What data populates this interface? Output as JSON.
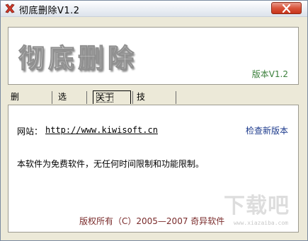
{
  "window": {
    "title": "彻底删除V1.2",
    "close_icon": "close-icon",
    "app_icon": "red-x-icon"
  },
  "banner": {
    "logo_text": "彻底删除",
    "version_label": "版本V1.2"
  },
  "tabs": [
    {
      "label": "删除文件",
      "active": false
    },
    {
      "label": "选项",
      "active": false
    },
    {
      "label": "关于",
      "active": true
    },
    {
      "label": "技术资料",
      "active": false
    }
  ],
  "about": {
    "website_label": "网站：",
    "website_url": "http://www.kiwisoft.cn",
    "check_update_label": "检查新版本",
    "description": "本软件为免费软件，无任何时间限制和功能限制。",
    "copyright": "版权所有（C）2005—2007 奇异软件"
  },
  "watermark": {
    "text": "下载吧",
    "url": "www.xiazaiba.com"
  },
  "colors": {
    "version_green": "#3a7f3a",
    "link_blue": "#1c3a8c",
    "copyright_red": "#7a2b2b",
    "close_red": "#d9543a"
  }
}
